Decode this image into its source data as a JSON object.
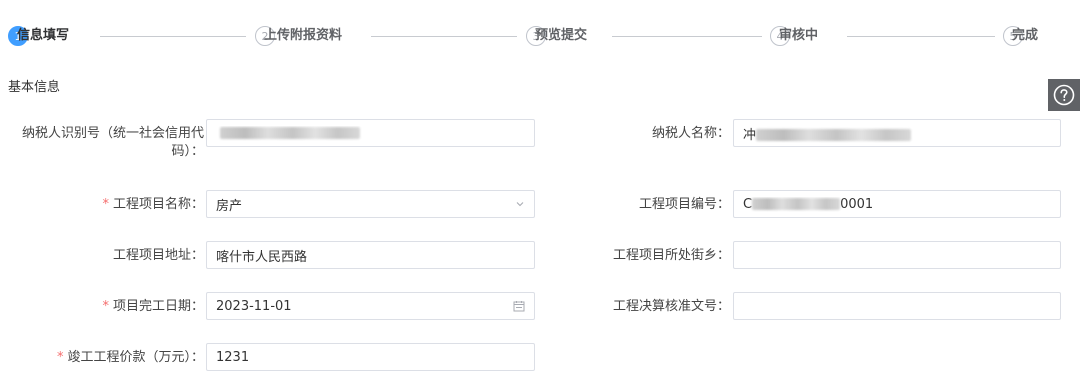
{
  "steps": [
    {
      "num": "1",
      "label": "信息填写",
      "active": true
    },
    {
      "num": "2",
      "label": "上传附报资料",
      "active": false
    },
    {
      "num": "3",
      "label": "预览提交",
      "active": false
    },
    {
      "num": "4",
      "label": "审核中",
      "active": false
    },
    {
      "num": "5",
      "label": "完成",
      "active": false
    }
  ],
  "section": {
    "title": "基本信息"
  },
  "help": {
    "icon": "question-circle-icon"
  },
  "form": {
    "taxpayer_id_label_line1": "纳税人识别号（统一社会信用代",
    "taxpayer_id_label_line2": "码）：",
    "taxpayer_id_value": "",
    "taxpayer_name_label": "纳税人名称：",
    "taxpayer_name_value_prefix": "冲",
    "project_name_label": "工程项目名称：",
    "project_name_value": "房产",
    "project_no_label": "工程项目编号：",
    "project_no_prefix": "C",
    "project_no_suffix": "0001",
    "project_address_label": "工程项目地址：",
    "project_address_value": "喀什市人民西路",
    "project_street_label": "工程项目所处街乡：",
    "project_street_value": "",
    "completion_date_label": "项目完工日期：",
    "completion_date_value": "2023-11-01",
    "settlement_no_label": "工程决算核准文号：",
    "settlement_no_value": "",
    "price_label": "竣工工程价款（万元）：",
    "price_value": "1231",
    "required_mark": "*"
  }
}
